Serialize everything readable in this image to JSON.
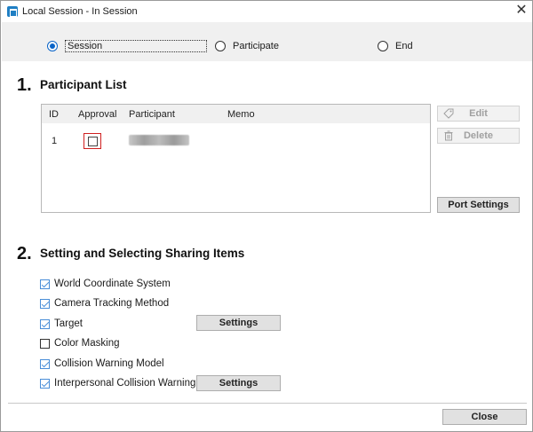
{
  "window": {
    "title": "Local Session - In Session",
    "close_glyph": "✕"
  },
  "modes": [
    {
      "label": "Session",
      "checked": true
    },
    {
      "label": "Participate",
      "checked": false
    },
    {
      "label": "End",
      "checked": false
    }
  ],
  "section1": {
    "number": "1.",
    "title": "Participant List",
    "columns": [
      "ID",
      "Approval",
      "Participant",
      "Memo"
    ],
    "rows": [
      {
        "id": "1",
        "approval": false,
        "participant": "",
        "memo": ""
      }
    ],
    "buttons": {
      "edit": "Edit",
      "delete": "Delete",
      "port_settings": "Port Settings"
    }
  },
  "section2": {
    "number": "2.",
    "title": "Setting and Selecting Sharing Items",
    "items": [
      {
        "label": "World Coordinate System",
        "checked": true
      },
      {
        "label": "Camera Tracking Method",
        "checked": true
      },
      {
        "label": "Target",
        "checked": true
      },
      {
        "label": "Color Masking",
        "checked": false
      },
      {
        "label": "Collision Warning Model",
        "checked": true
      },
      {
        "label": "Interpersonal Collision Warning",
        "checked": true
      }
    ],
    "settings_label": "Settings"
  },
  "footer": {
    "close_label": "Close"
  }
}
